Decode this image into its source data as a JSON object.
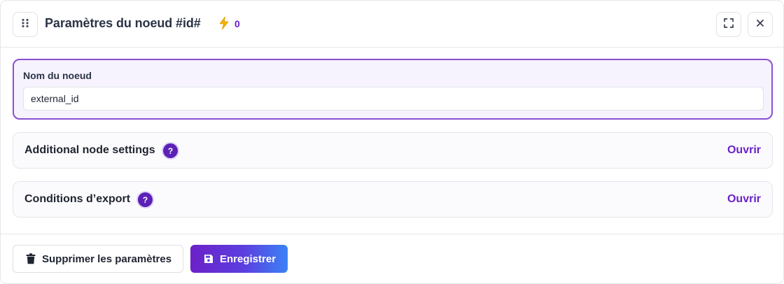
{
  "header": {
    "title": "Paramètres du noeud #id#",
    "trigger_count": "0",
    "icons": {
      "drag": "drag-handle-icon",
      "bolt": "lightning-bolt-icon",
      "expand": "fullscreen-icon",
      "close": "close-icon"
    }
  },
  "name_field": {
    "label": "Nom du noeud",
    "value": "external_id"
  },
  "sections": [
    {
      "title": "Additional node settings",
      "help": "?",
      "action": "Ouvrir"
    },
    {
      "title": "Conditions d’export",
      "help": "?",
      "action": "Ouvrir"
    }
  ],
  "footer": {
    "delete_label": "Supprimer les paramètres",
    "save_label": "Enregistrer"
  },
  "colors": {
    "accent": "#6b21c8",
    "field_border": "#8a4fd0",
    "field_bg": "#f6f3ff",
    "bolt": "#f5b301",
    "save_gradient_end": "#3b82f6"
  }
}
